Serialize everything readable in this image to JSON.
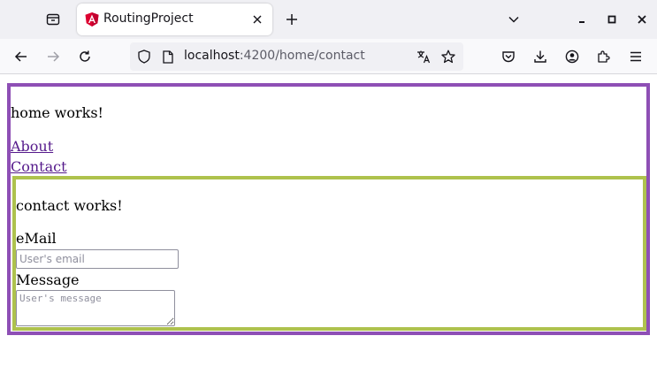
{
  "browser": {
    "tab": {
      "title": "RoutingProject"
    },
    "url": {
      "host": "localhost",
      "rest": ":4200/home/contact"
    }
  },
  "page": {
    "home_text": "home works!",
    "links": [
      "About",
      "Contact"
    ],
    "contact": {
      "title": "contact works!",
      "email_label": "eMail",
      "email_placeholder": "User's email",
      "message_label": "Message",
      "message_placeholder": "User's message"
    }
  },
  "colors": {
    "home_border": "#8e4fb5",
    "contact_border": "#aec24d",
    "link": "#551a8b"
  }
}
